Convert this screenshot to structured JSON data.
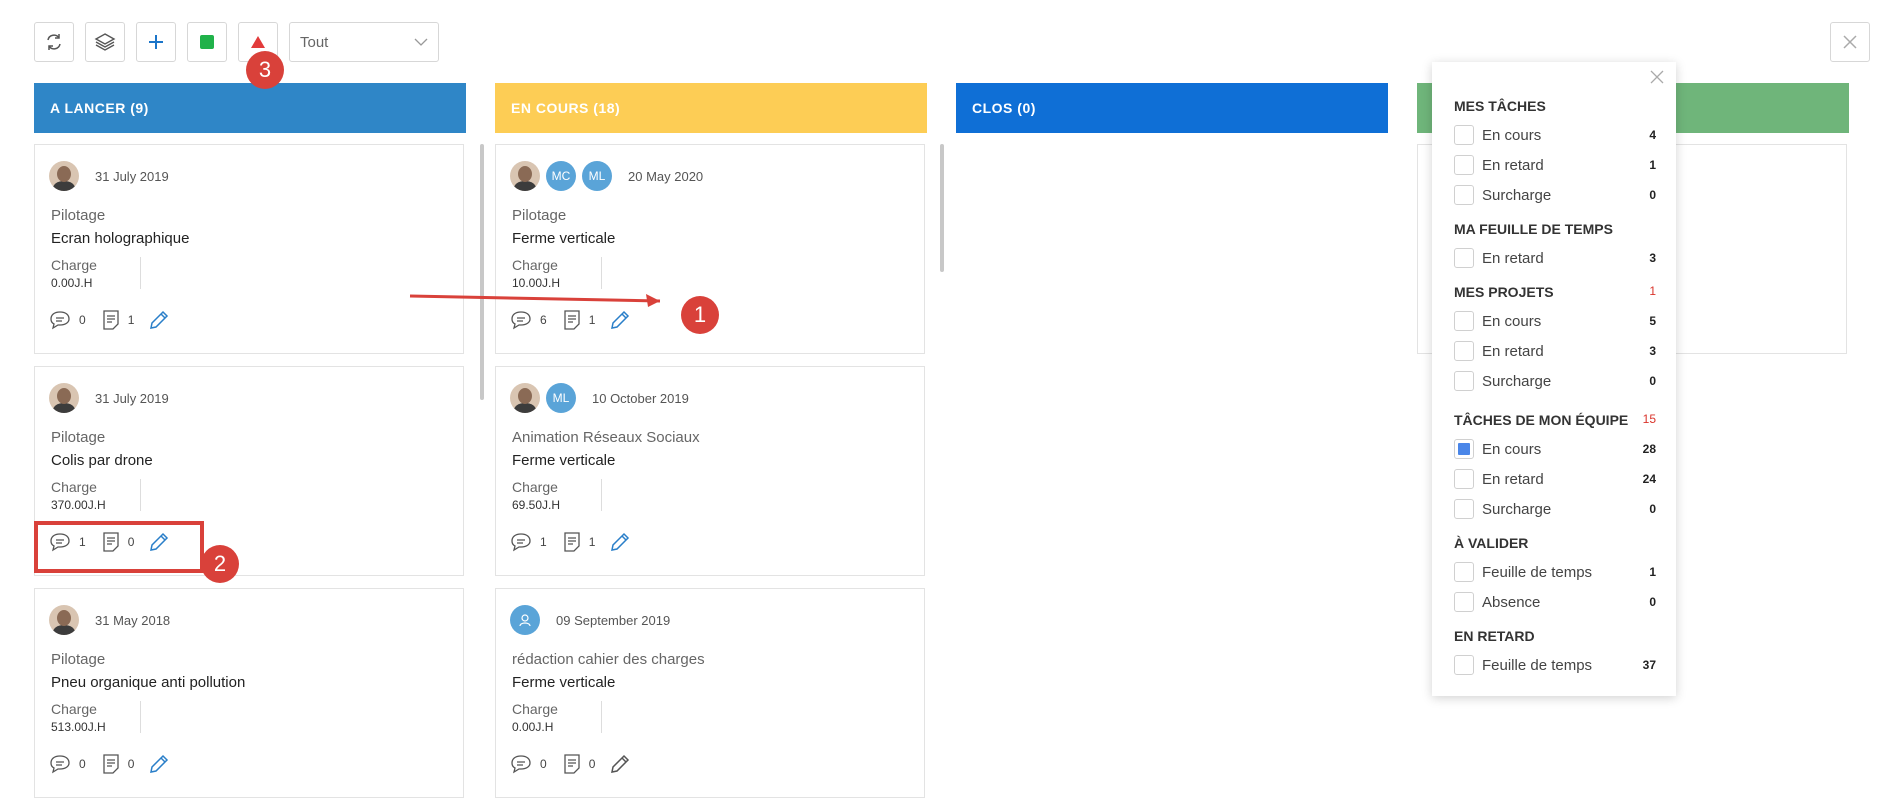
{
  "toolbar": {
    "filter_select": "Tout"
  },
  "annotations": {
    "n1": "1",
    "n2": "2",
    "n3": "3"
  },
  "columns": [
    {
      "title": "A LANCER (9)",
      "color": "#2f86c7",
      "cards": [
        {
          "date": "31 July 2019",
          "project": "Pilotage",
          "title": "Ecran holographique",
          "charge_label": "Charge",
          "charge": "0.00J.H",
          "comments": "0",
          "docs": "1"
        },
        {
          "date": "31 July 2019",
          "project": "Pilotage",
          "title": "Colis par drone",
          "charge_label": "Charge",
          "charge": "370.00J.H",
          "comments": "1",
          "docs": "0"
        },
        {
          "date": "31 May 2018",
          "project": "Pilotage",
          "title": "Pneu organique anti pollution",
          "charge_label": "Charge",
          "charge": "513.00J.H",
          "comments": "0",
          "docs": "0"
        }
      ]
    },
    {
      "title": "EN COURS (18)",
      "color": "#fdcd55",
      "cards": [
        {
          "chips": [
            "MC",
            "ML"
          ],
          "date": "20 May 2020",
          "project": "Pilotage",
          "title": "Ferme verticale",
          "charge_label": "Charge",
          "charge": "10.00J.H",
          "comments": "6",
          "docs": "1"
        },
        {
          "chips": [
            "ML"
          ],
          "date": "10 October 2019",
          "project": "Animation Réseaux Sociaux",
          "title": "Ferme verticale",
          "charge_label": "Charge",
          "charge": "69.50J.H",
          "comments": "1",
          "docs": "1"
        },
        {
          "date": "09 September 2019",
          "project": "rédaction cahier des charges",
          "title": "Ferme verticale",
          "charge_label": "Charge",
          "charge": "0.00J.H",
          "comments": "0",
          "docs": "0"
        }
      ]
    },
    {
      "title": "CLOS (0)",
      "color": "#0f6fd6"
    },
    {
      "title": "",
      "color": "#6fb57a"
    }
  ],
  "filter_panel": {
    "sections": [
      {
        "title": "MES TÂCHES",
        "count": "",
        "items": [
          {
            "label": "En cours",
            "value": "4",
            "checked": false
          },
          {
            "label": "En retard",
            "value": "1",
            "checked": false
          },
          {
            "label": "Surcharge",
            "value": "0",
            "checked": false
          }
        ]
      },
      {
        "title": "MA FEUILLE DE TEMPS",
        "count": "",
        "items": [
          {
            "label": "En retard",
            "value": "3",
            "checked": false
          }
        ]
      },
      {
        "title": "MES PROJETS",
        "count": "1",
        "items": [
          {
            "label": "En cours",
            "value": "5",
            "checked": false
          },
          {
            "label": "En retard",
            "value": "3",
            "checked": false
          },
          {
            "label": "Surcharge",
            "value": "0",
            "checked": false
          }
        ]
      },
      {
        "title": "TÂCHES DE MON ÉQUIPE",
        "count": "15",
        "items": [
          {
            "label": "En cours",
            "value": "28",
            "checked": true
          },
          {
            "label": "En retard",
            "value": "24",
            "checked": false
          },
          {
            "label": "Surcharge",
            "value": "0",
            "checked": false
          }
        ]
      },
      {
        "title": "À VALIDER",
        "count": "",
        "items": [
          {
            "label": "Feuille de temps",
            "value": "1",
            "checked": false
          },
          {
            "label": "Absence",
            "value": "0",
            "checked": false
          }
        ]
      },
      {
        "title": "EN RETARD",
        "count": "",
        "items": [
          {
            "label": "Feuille de temps",
            "value": "37",
            "checked": false
          }
        ]
      }
    ]
  }
}
